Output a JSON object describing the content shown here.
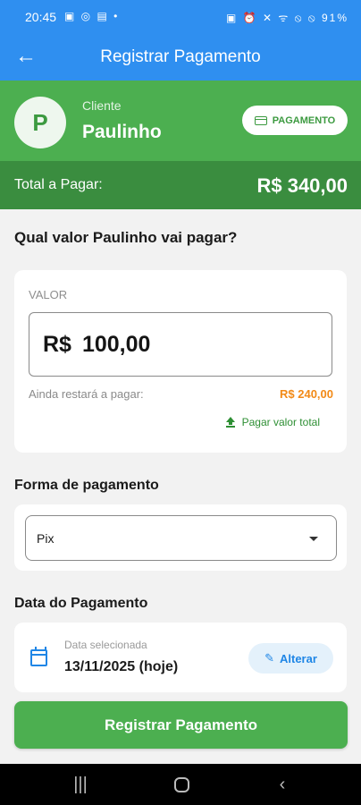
{
  "status_bar": {
    "time": "20:45",
    "left_icons": [
      "image-icon",
      "whatsapp-icon",
      "gallery-icon",
      "dot-icon"
    ],
    "left_icons_glyphs": "▣ ◎ ▤ •",
    "right_icons_glyphs": "▣ ⏰ ✕ ᯤ ⦸ ⦸",
    "battery": "91%"
  },
  "app_bar": {
    "title": "Registrar Pagamento",
    "back_glyph": "←"
  },
  "client": {
    "avatar_letter": "P",
    "label": "Cliente",
    "name": "Paulinho",
    "badge_label": "PAGAMENTO"
  },
  "total": {
    "label": "Total a Pagar:",
    "value": "R$ 340,00"
  },
  "payment_amount": {
    "question": "Qual valor Paulinho vai pagar?",
    "field_label": "VALOR",
    "currency": "R$",
    "amount": "100,00",
    "remaining_label": "Ainda restará a pagar:",
    "remaining_value": "R$ 240,00",
    "pay_full_label": "Pagar valor total"
  },
  "payment_method": {
    "section_title": "Forma de pagamento",
    "selected": "Pix"
  },
  "payment_date": {
    "section_title": "Data do Pagamento",
    "sub_label": "Data selecionada",
    "date": "13/11/2025 (hoje)",
    "change_label": "Alterar"
  },
  "submit": {
    "label": "Registrar Pagamento"
  },
  "nav_bar": {
    "recents_glyph": "|||",
    "back_glyph": "‹"
  },
  "colors": {
    "primary_blue": "#2f8ff0",
    "green": "#4caf50",
    "dark_green": "#3a8d3f",
    "orange": "#f28a17"
  }
}
